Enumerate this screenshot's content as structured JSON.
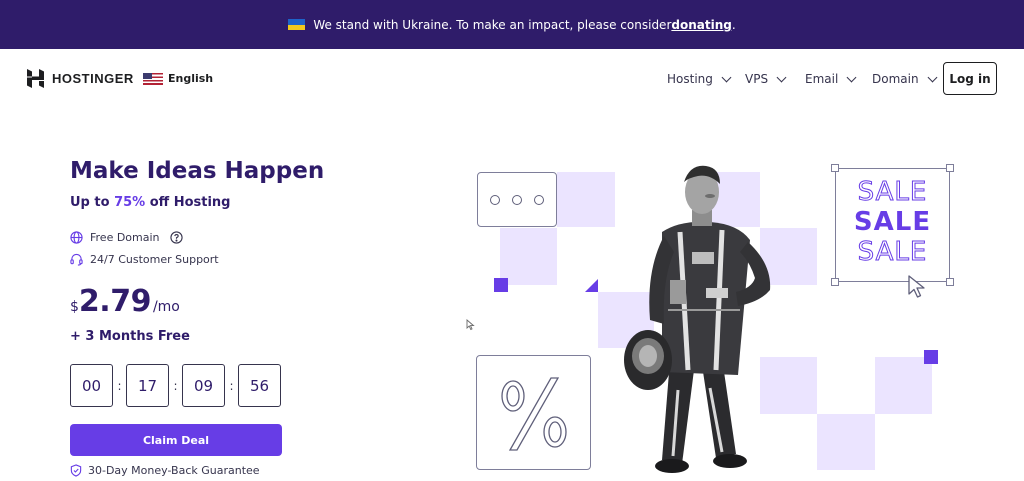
{
  "banner": {
    "text": "We stand with Ukraine. To make an impact, please consider ",
    "link": "donating",
    "suffix": "."
  },
  "header": {
    "brand": "HOSTINGER",
    "language": "English",
    "nav": [
      {
        "label": "Hosting",
        "icon": "chevron-down-icon"
      },
      {
        "label": "VPS",
        "icon": "chevron-down-icon"
      },
      {
        "label": "Email",
        "icon": "chevron-down-icon"
      },
      {
        "label": "Domain",
        "icon": "chevron-down-icon"
      }
    ],
    "login_label": "Log in"
  },
  "hero": {
    "title": "Make Ideas Happen",
    "subtitle_pre": "Up to ",
    "subtitle_pct": "75%",
    "subtitle_post": " off Hosting",
    "features": [
      {
        "label": "Free Domain",
        "icon": "globe-icon",
        "extra_icon": "help-circle-icon"
      },
      {
        "label": "24/7 Customer Support",
        "icon": "headset-icon"
      }
    ],
    "price": {
      "currency": "$",
      "amount": "2.79",
      "period": "/mo"
    },
    "bonus": "+ 3 Months Free",
    "countdown": {
      "days": "00",
      "hours": "17",
      "minutes": "09",
      "seconds": "56",
      "separator": ":"
    },
    "cta_label": "Claim Deal",
    "guarantee": "30-Day Money-Back Guarantee"
  },
  "art": {
    "percent_symbol": "%",
    "sale_words": [
      "SALE",
      "SALE",
      "SALE"
    ],
    "accent_color": "#673de6",
    "tile_color": "#ebe4ff"
  }
}
